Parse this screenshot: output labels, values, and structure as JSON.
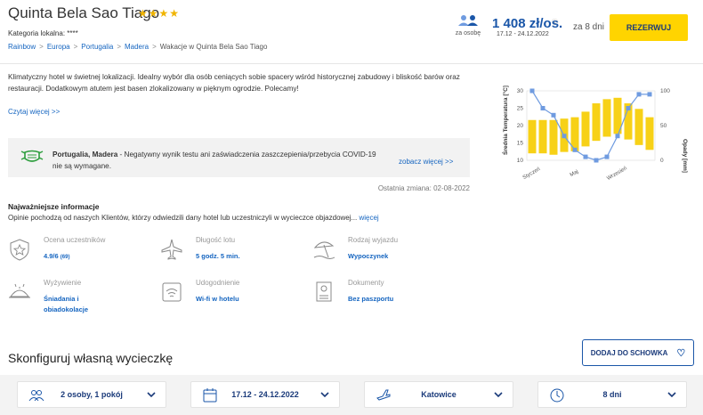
{
  "header": {
    "hotel_name": "Quinta Bela Sao Tiago",
    "stars": "★★★★",
    "category": "Kategoria lokalna: ****",
    "breadcrumb": [
      "Rainbow",
      "Europa",
      "Portugalia",
      "Madera"
    ],
    "breadcrumb_current": "Wakacje w Quinta Bela Sao Tiago",
    "per_person_label": "za osobę",
    "price": "1 408 zł/os.",
    "price_info_icon": "ⓘ",
    "price_dates": "17.12 - 24.12.2022",
    "days": "za 8 dni",
    "reserve_label": "REZERWUJ"
  },
  "description": {
    "text": "Klimatyczny hotel w świetnej lokalizacji. Idealny wybór dla osób ceniących sobie spacery wśród historycznej zabudowy i bliskość barów oraz restauracji. Dodatkowym atutem jest basen zlokalizowany w pięknym ogrodzie. Polecamy!",
    "read_more": "Czytaj więcej >>"
  },
  "covid": {
    "bold": "Portugalia, Madera",
    "text": " - Negatywny wynik testu ani zaświadczenia zaszczepienia/przebycia COVID-19 nie są wymagane.",
    "see_more": "zobacz więcej >>",
    "last_change": "Ostatnia zmiana: 02-08-2022"
  },
  "climate_chart": {
    "left_axis_label": "Średnia Temperatura [°C]",
    "right_axis_label": "Opady [mm]",
    "left_ticks": [
      "30",
      "25",
      "20",
      "15",
      "10"
    ],
    "right_ticks": [
      "100",
      "50",
      "0"
    ],
    "x_labels": [
      "Styczeń",
      "Maj",
      "Wrzesień"
    ]
  },
  "info": {
    "title": "Najważniejsze informacje",
    "desc": "Opinie pochodzą od naszych Klientów, którzy odwiedzili dany hotel lub uczestniczyli w wycieczce objazdowej...",
    "desc_link": "więcej",
    "items": [
      {
        "label": "Ocena uczestników",
        "value": "4.9/6",
        "extra": "(69)"
      },
      {
        "label": "Długość lotu",
        "value": "5 godz. 5 min."
      },
      {
        "label": "Rodzaj wyjazdu",
        "value": "Wypoczynek"
      },
      {
        "label": "Wyżywienie",
        "value": "Śniadania i obiadokolacje"
      },
      {
        "label": "Udogodnienie",
        "value": "Wi-fi w hotelu"
      },
      {
        "label": "Dokumenty",
        "value": "Bez paszportu"
      }
    ]
  },
  "configure": {
    "title": "Skonfiguruj własną wycieczkę",
    "save_label": "DODAJ DO SCHOWKA",
    "fields": [
      "2 osoby, 1 pokój",
      "17.12 - 24.12.2022",
      "Katowice",
      "8 dni"
    ]
  },
  "colors": {
    "accent": "#1a56a8",
    "button": "#ffd400",
    "chart_bar": "#f7d117",
    "chart_line": "#6f9be0"
  },
  "chart_data": {
    "type": "bar",
    "categories": [
      "1",
      "2",
      "3",
      "4",
      "5",
      "6",
      "7",
      "8",
      "9",
      "10",
      "11",
      "12"
    ],
    "series": [
      {
        "name": "Opady [mm]",
        "kind": "bar",
        "axis": "right",
        "values": [
          [
            10,
            58
          ],
          [
            10,
            58
          ],
          [
            8,
            58
          ],
          [
            12,
            60
          ],
          [
            13,
            62
          ],
          [
            20,
            70
          ],
          [
            28,
            82
          ],
          [
            34,
            88
          ],
          [
            38,
            90
          ],
          [
            30,
            82
          ],
          [
            22,
            74
          ],
          [
            15,
            62
          ]
        ]
      },
      {
        "name": "Średnia Temperatura [°C]",
        "kind": "line",
        "axis": "left",
        "values": [
          30,
          25,
          23,
          17,
          13,
          11,
          10,
          11,
          17,
          25,
          29,
          29
        ]
      }
    ],
    "ylim_left": [
      10,
      30
    ],
    "ylim_right": [
      0,
      100
    ]
  }
}
